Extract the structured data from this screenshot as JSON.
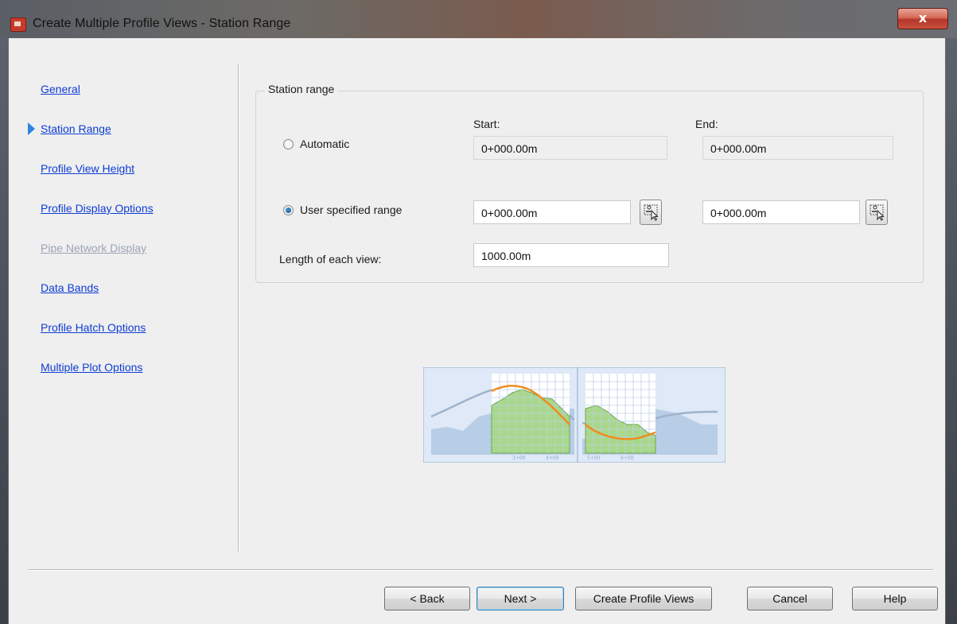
{
  "window": {
    "title": "Create Multiple Profile Views - Station Range",
    "close_label": "x"
  },
  "nav": {
    "items": [
      {
        "label": "General",
        "state": "enabled"
      },
      {
        "label": "Station Range",
        "state": "current"
      },
      {
        "label": "Profile View Height",
        "state": "enabled"
      },
      {
        "label": "Profile Display Options",
        "state": "enabled"
      },
      {
        "label": "Pipe Network Display",
        "state": "disabled"
      },
      {
        "label": "Data Bands",
        "state": "enabled"
      },
      {
        "label": "Profile Hatch Options",
        "state": "enabled"
      },
      {
        "label": "Multiple Plot Options",
        "state": "enabled"
      }
    ]
  },
  "station_range": {
    "group_title": "Station range",
    "start_label": "Start:",
    "end_label": "End:",
    "automatic": {
      "label": "Automatic",
      "selected": false,
      "start": "0+000.00m",
      "end": "0+000.00m"
    },
    "user_specified": {
      "label": "User specified range",
      "selected": true,
      "start": "0+000.00m",
      "end": "0+000.00m"
    },
    "length_label": "Length of each view:",
    "length_value": "1000.00m"
  },
  "preview": {
    "tick_labels": [
      "3+00",
      "4+00",
      "5+00",
      "6+00"
    ],
    "colors": {
      "ground": "#a8d88a",
      "profile": "#f08c1e",
      "surface": "#aebfd6",
      "background": "#dfe9f7"
    }
  },
  "buttons": {
    "back": "< Back",
    "next": "Next >",
    "create": "Create Profile Views",
    "cancel": "Cancel",
    "help": "Help"
  }
}
